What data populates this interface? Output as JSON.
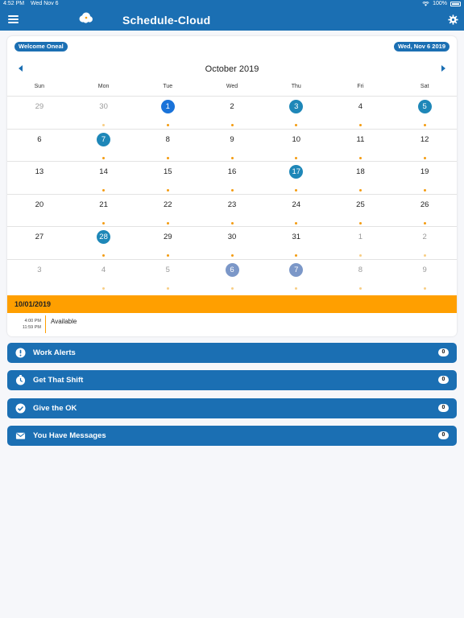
{
  "status_bar": {
    "time": "4:52 PM",
    "date": "Wed Nov 6",
    "battery": "100%",
    "wifi_icon": "wifi-icon",
    "battery_icon": "battery-icon"
  },
  "header": {
    "title": "Schedule-Cloud",
    "menu_icon": "hamburger-icon",
    "logo_icon": "cloud-logo-icon",
    "settings_icon": "gear-icon"
  },
  "colors": {
    "primary": "#1b6fb3",
    "accent": "#ff9f00",
    "dot": "#f39c12"
  },
  "badges": {
    "welcome": "Welcome Oneal",
    "today": "Wed, Nov 6 2019"
  },
  "calendar": {
    "month_title": "October 2019",
    "weekdays": [
      "Sun",
      "Mon",
      "Tue",
      "Wed",
      "Thu",
      "Fri",
      "Sat"
    ],
    "weeks": [
      [
        {
          "n": "29",
          "muted": true
        },
        {
          "n": "30",
          "muted": true,
          "dot": true
        },
        {
          "n": "1",
          "hl": "today",
          "dot": true
        },
        {
          "n": "2",
          "dot": true
        },
        {
          "n": "3",
          "hl": "circle",
          "dot": true
        },
        {
          "n": "4",
          "dot": true
        },
        {
          "n": "5",
          "hl": "circle",
          "dot": true
        }
      ],
      [
        {
          "n": "6"
        },
        {
          "n": "7",
          "hl": "circle",
          "dot": true
        },
        {
          "n": "8",
          "dot": true
        },
        {
          "n": "9",
          "dot": true
        },
        {
          "n": "10",
          "dot": true
        },
        {
          "n": "11",
          "dot": true
        },
        {
          "n": "12",
          "dot": true
        }
      ],
      [
        {
          "n": "13"
        },
        {
          "n": "14",
          "dot": true
        },
        {
          "n": "15",
          "dot": true
        },
        {
          "n": "16",
          "dot": true
        },
        {
          "n": "17",
          "hl": "circle",
          "dot": true
        },
        {
          "n": "18",
          "dot": true
        },
        {
          "n": "19",
          "dot": true
        }
      ],
      [
        {
          "n": "20"
        },
        {
          "n": "21",
          "dot": true
        },
        {
          "n": "22",
          "dot": true
        },
        {
          "n": "23",
          "dot": true
        },
        {
          "n": "24",
          "dot": true
        },
        {
          "n": "25",
          "dot": true
        },
        {
          "n": "26",
          "dot": true
        }
      ],
      [
        {
          "n": "27"
        },
        {
          "n": "28",
          "hl": "circle",
          "dot": true
        },
        {
          "n": "29",
          "dot": true
        },
        {
          "n": "30",
          "dot": true
        },
        {
          "n": "31",
          "dot": true
        },
        {
          "n": "1",
          "muted": true,
          "dot": true
        },
        {
          "n": "2",
          "muted": true,
          "dot": true
        }
      ],
      [
        {
          "n": "3",
          "muted": true
        },
        {
          "n": "4",
          "muted": true,
          "dot": true
        },
        {
          "n": "5",
          "muted": true,
          "dot": true
        },
        {
          "n": "6",
          "muted": true,
          "hl": "circle-muted",
          "dot": true
        },
        {
          "n": "7",
          "muted": true,
          "hl": "circle-muted",
          "dot": true
        },
        {
          "n": "8",
          "muted": true,
          "dot": true
        },
        {
          "n": "9",
          "muted": true,
          "dot": true
        }
      ]
    ]
  },
  "selected": {
    "date": "10/01/2019",
    "entries": [
      {
        "start": "4:00 PM",
        "end": "11:59 PM",
        "label": "Available"
      }
    ]
  },
  "alerts": [
    {
      "label": "Work Alerts",
      "count": "0",
      "icon": "exclamation-icon"
    },
    {
      "label": "Get That Shift",
      "count": "0",
      "icon": "clock-icon"
    },
    {
      "label": "Give the OK",
      "count": "0",
      "icon": "checkmark-icon"
    },
    {
      "label": "You Have Messages",
      "count": "0",
      "icon": "envelope-icon"
    }
  ]
}
